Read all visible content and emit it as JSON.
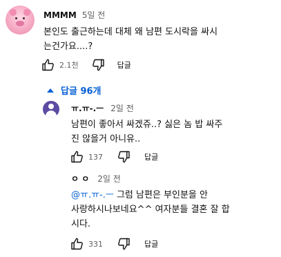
{
  "comment": {
    "username": "MMMM",
    "time": "5일 전",
    "text_line1": "본인도 출근하는데 대체 왜 남편 도시락을 싸시",
    "text_line2": "는건가요....?",
    "like_count": "2.1천",
    "reply_label": "답글"
  },
  "replies_toggle": {
    "label": "답글 96개"
  },
  "reply1": {
    "username": "ㅠ.ㅠ-.ㅡ",
    "time": "2일 전",
    "text_line1": "남편이 좋아서 싸겠쥬..? 싫은 놈 밥 싸주",
    "text_line2": "진 않을거 아니유..",
    "like_count": "137",
    "reply_label": "답글"
  },
  "reply2": {
    "username": "ㅇ ㅇ",
    "time": "2일 전",
    "mention": "@ㅠ.ㅠ-.ㅡ",
    "text_after_mention": " 그럼 남편은 부인분을 안",
    "text_line2": "사랑하시나보네요^^ 여자분들 결혼 잘 합",
    "text_line3": "시다.",
    "like_count": "331",
    "reply_label": "답글"
  }
}
